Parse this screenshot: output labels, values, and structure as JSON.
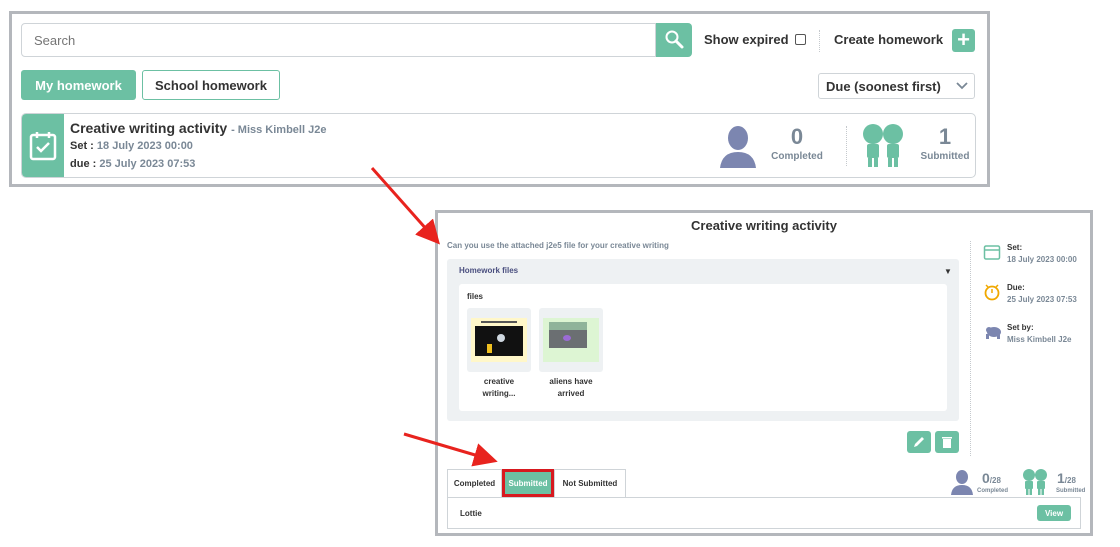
{
  "search": {
    "placeholder": "Search",
    "value": ""
  },
  "filters": {
    "show_expired_label": "Show expired",
    "show_expired_checked": false
  },
  "create": {
    "label": "Create homework",
    "button_glyph": "+"
  },
  "tabs": [
    {
      "label": "My homework",
      "active": true
    },
    {
      "label": "School homework",
      "active": false
    }
  ],
  "sort": {
    "selected": "Due (soonest first)"
  },
  "homework": {
    "title": "Creative writing activity",
    "teacher": "- Miss Kimbell J2e",
    "set_label": "Set :",
    "set_date": "18 July 2023 00:00",
    "due_label": "due :",
    "due_date": "25 July 2023 07:53",
    "completed_count": "0",
    "completed_label": "Completed",
    "submitted_count": "1",
    "submitted_label": "Submitted"
  },
  "detail": {
    "title": "Creative writing activity",
    "description": "Can you use the attached j2e5 file for your creative writing",
    "files_header": "Homework files",
    "files_label": "files",
    "files": [
      {
        "name_line1": "creative",
        "name_line2": "writing..."
      },
      {
        "name_line1": "aliens have",
        "name_line2": "arrived"
      }
    ],
    "side": {
      "set_label": "Set:",
      "set_value": "18 July 2023 00:00",
      "due_label": "Due:",
      "due_value": "25 July 2023 07:53",
      "setby_label": "Set by:",
      "setby_value": "Miss Kimbell J2e"
    },
    "subtabs": [
      {
        "label": "Completed",
        "active": false
      },
      {
        "label": "Submitted",
        "active": true
      },
      {
        "label": "Not Submitted",
        "active": false
      }
    ],
    "mini": {
      "completed_num": "0",
      "completed_den": "/28",
      "completed_label": "Completed",
      "submitted_num": "1",
      "submitted_den": "/28",
      "submitted_label": "Submitted"
    },
    "students": [
      {
        "name": "Lottie",
        "view_label": "View"
      }
    ]
  },
  "colors": {
    "accent": "#6cc0a3",
    "highlight": "#d7191f",
    "muted": "#7a8896",
    "panel_border": "#b4b7bc"
  }
}
